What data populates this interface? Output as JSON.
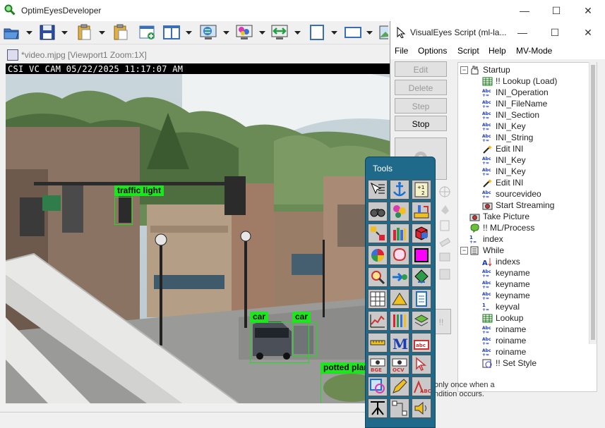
{
  "app": {
    "title": "OptimEyesDeveloper",
    "window_controls": [
      "—",
      "☐",
      "✕"
    ]
  },
  "toolbar": {
    "buttons": [
      {
        "name": "open-icon",
        "color": "#2b6cb0"
      },
      {
        "name": "save-icon",
        "color": "#1d3c8f"
      },
      {
        "name": "paste-icon",
        "color": "#d4a52b"
      },
      {
        "name": "copy-icon",
        "color": "#d4a52b"
      },
      {
        "name": "new-window-icon",
        "color": "#2e8b57"
      },
      {
        "name": "split-view-icon",
        "color": "#3a6fb5"
      },
      {
        "name": "globe-monitor-icon",
        "color": "#3a6fb5"
      },
      {
        "name": "colorful-monitor-icon",
        "color": "#b03aa8"
      },
      {
        "name": "sync-monitor-icon",
        "color": "#28a745"
      },
      {
        "name": "frame-icon",
        "color": "#3a6fb5"
      },
      {
        "name": "rectangle-icon",
        "color": "#3a6fb5"
      },
      {
        "name": "image-icon",
        "color": "#3a6fb5"
      }
    ]
  },
  "document": {
    "tab_title": "*video.mjpg [Viewport1 Zoom:1X]",
    "camera_overlay": "CSI VC CAM 05/22/2025 11:17:07 AM",
    "detections": [
      {
        "label": "traffic light"
      },
      {
        "label": "car"
      },
      {
        "label": "car"
      },
      {
        "label": "potted plant"
      }
    ]
  },
  "script_window": {
    "title": "VisualEyes Script (ml-la...",
    "controls": [
      "—",
      "☐",
      "✕"
    ],
    "menu": [
      "File",
      "Options",
      "Script",
      "Help",
      "MV-Mode"
    ],
    "buttons": {
      "edit": "Edit",
      "delete": "Delete",
      "step": "Step",
      "stop": "Stop"
    },
    "tree": [
      {
        "label": "Startup",
        "icon": "hand-icon",
        "level": 0,
        "expander": "−"
      },
      {
        "label": "!! Lookup (Load)",
        "icon": "table-icon",
        "level": 1
      },
      {
        "label": "INI_Operation",
        "icon": "abc-icon",
        "level": 1
      },
      {
        "label": "INI_FileName",
        "icon": "abc-icon",
        "level": 1
      },
      {
        "label": "INI_Section",
        "icon": "abc-icon",
        "level": 1
      },
      {
        "label": "INI_Key",
        "icon": "abc-icon",
        "level": 1
      },
      {
        "label": "INI_String",
        "icon": "abc-icon",
        "level": 1
      },
      {
        "label": "Edit INI",
        "icon": "wand-icon",
        "level": 1
      },
      {
        "label": "INI_Key",
        "icon": "abc-icon",
        "level": 1
      },
      {
        "label": "INI_Key",
        "icon": "abc-icon",
        "level": 1
      },
      {
        "label": "Edit INI",
        "icon": "wand-icon",
        "level": 1
      },
      {
        "label": "sourcevideo",
        "icon": "abc-icon",
        "level": 1
      },
      {
        "label": "Start Streaming",
        "icon": "camera-icon",
        "level": 1
      },
      {
        "label": "Take Picture",
        "icon": "camera-icon",
        "level": 0
      },
      {
        "label": "!! ML/Process",
        "icon": "brain-icon",
        "level": 0
      },
      {
        "label": "index",
        "icon": "counter-icon",
        "level": 0
      },
      {
        "label": "While",
        "icon": "loop-icon",
        "level": 0,
        "expander": "−"
      },
      {
        "label": "indexs",
        "icon": "sort-icon",
        "level": 1
      },
      {
        "label": "keyname",
        "icon": "abc-icon",
        "level": 1
      },
      {
        "label": "keyname",
        "icon": "abc-icon",
        "level": 1
      },
      {
        "label": "keyname",
        "icon": "abc-icon",
        "level": 1
      },
      {
        "label": "keyval",
        "icon": "counter-icon",
        "level": 1
      },
      {
        "label": "Lookup",
        "icon": "table-icon",
        "level": 1
      },
      {
        "label": "roiname",
        "icon": "abc-icon",
        "level": 1
      },
      {
        "label": "roiname",
        "icon": "abc-icon",
        "level": 1
      },
      {
        "label": "roiname",
        "icon": "abc-icon",
        "level": 1
      },
      {
        "label": "!! Set Style",
        "icon": "style-icon",
        "level": 1
      }
    ],
    "help_text_lines": [
      "only once when a",
      "ndition occurs."
    ]
  },
  "tools_palette": {
    "title": "Tools",
    "tools": [
      "select-list-icon",
      "anchor-icon",
      "calculator-icon",
      "binoculars-icon",
      "blob-icon",
      "ruler-measure-icon",
      "pixel-grid-icon",
      "crayons-icon",
      "cube-icon",
      "color-wheel-icon",
      "brain-outline-icon",
      "magenta-square-icon",
      "magnifier-icon",
      "flow-arrow-icon",
      "diamond-arrows-icon",
      "number-grid-icon",
      "triangle-icon",
      "document-icon",
      "line-chart-icon",
      "bars-grid-icon",
      "layers-icon",
      "ruler-icon",
      "letter-m-icon",
      "abc-frame-icon",
      "bge-camera-icon",
      "ocv-camera-icon",
      "pointer-icon",
      "overlay-square-icon",
      "pen-icon",
      "abc-draw-icon",
      "crossing-icon",
      "nodes-icon",
      "speaker-icon"
    ]
  }
}
